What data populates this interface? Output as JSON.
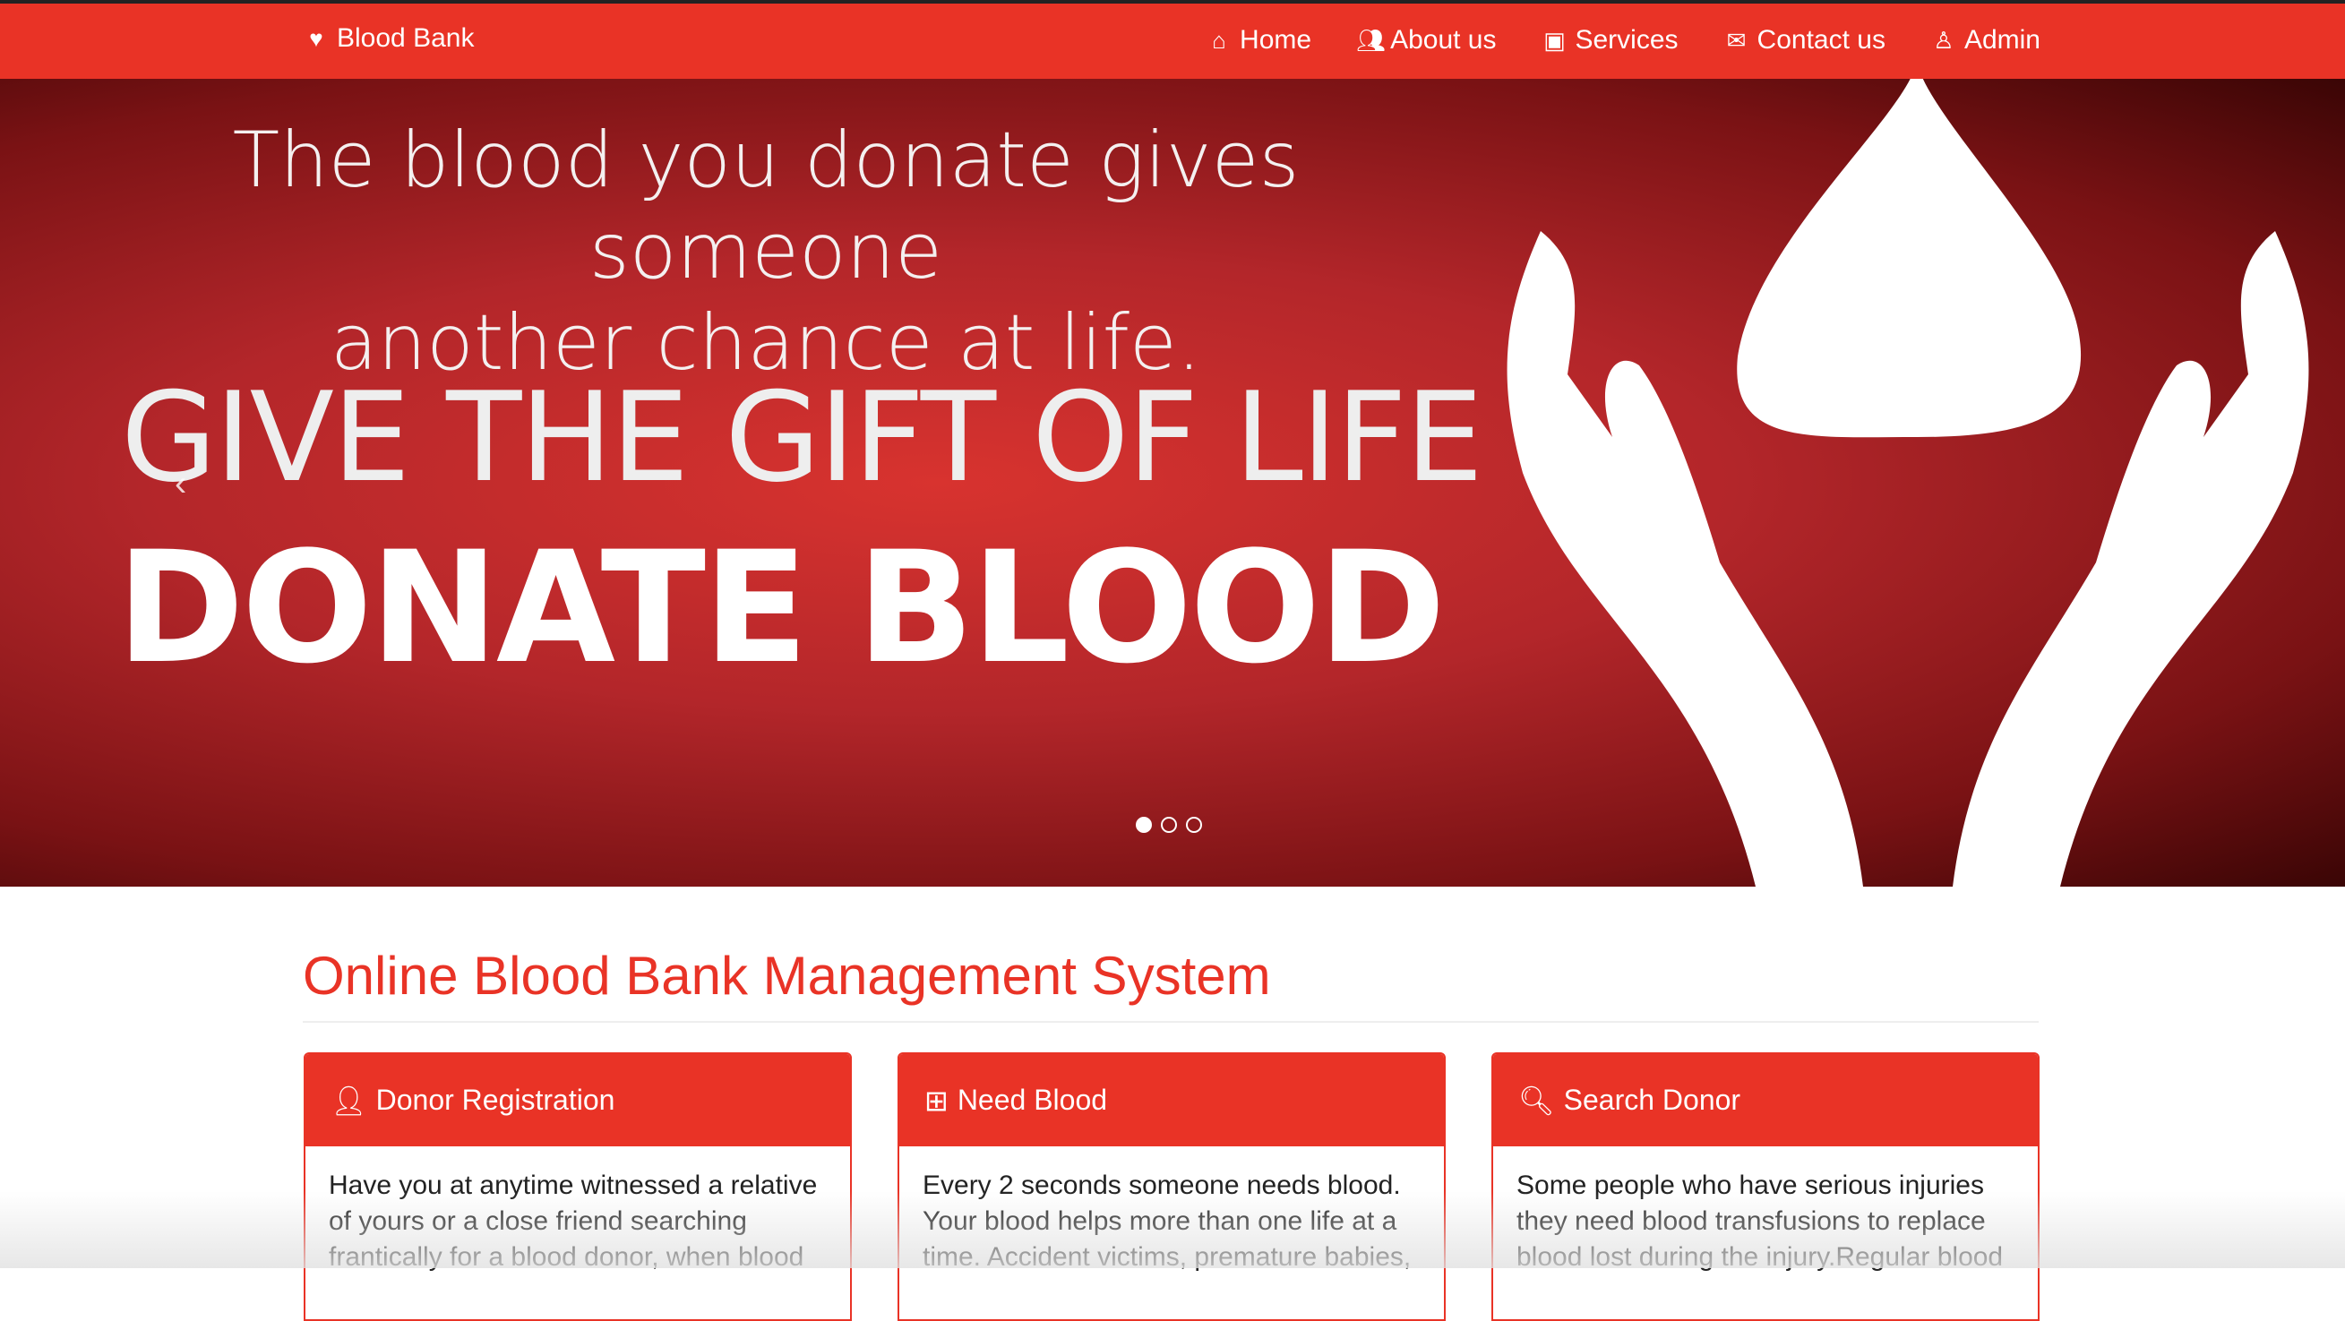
{
  "nav": {
    "brand": "Blood Bank",
    "items": [
      {
        "label": "Home",
        "icon": "home-icon"
      },
      {
        "label": "About us",
        "icon": "users-icon"
      },
      {
        "label": "Services",
        "icon": "briefcase-icon"
      },
      {
        "label": "Contact us",
        "icon": "envelope-icon"
      },
      {
        "label": "Admin",
        "icon": "user-secret-icon"
      }
    ]
  },
  "hero": {
    "line1": "The blood you donate gives someone",
    "line2": "another chance at life.",
    "line3": "GIVE THE GIFT OF LIFE",
    "line4": "DONATE BLOOD",
    "active_slide": 1,
    "slide_count": 3
  },
  "main": {
    "title": "Online Blood Bank Management System",
    "panels": [
      {
        "title": "Donor Registration",
        "icon": "user-icon",
        "text": "Have you at anytime witnessed a relative of yours or a close friend searching frantically for a blood donor, when blood"
      },
      {
        "title": "Need Blood",
        "icon": "medkit-icon",
        "text": "Every 2 seconds someone needs blood. Your blood helps more than one life at a time. Accident victims, premature babies,"
      },
      {
        "title": "Search Donor",
        "icon": "search-icon",
        "text": "Some people who have serious injuries they need blood transfusions to replace blood lost during the injury.Regular blood"
      }
    ]
  },
  "colors": {
    "brand": "#e93326"
  }
}
